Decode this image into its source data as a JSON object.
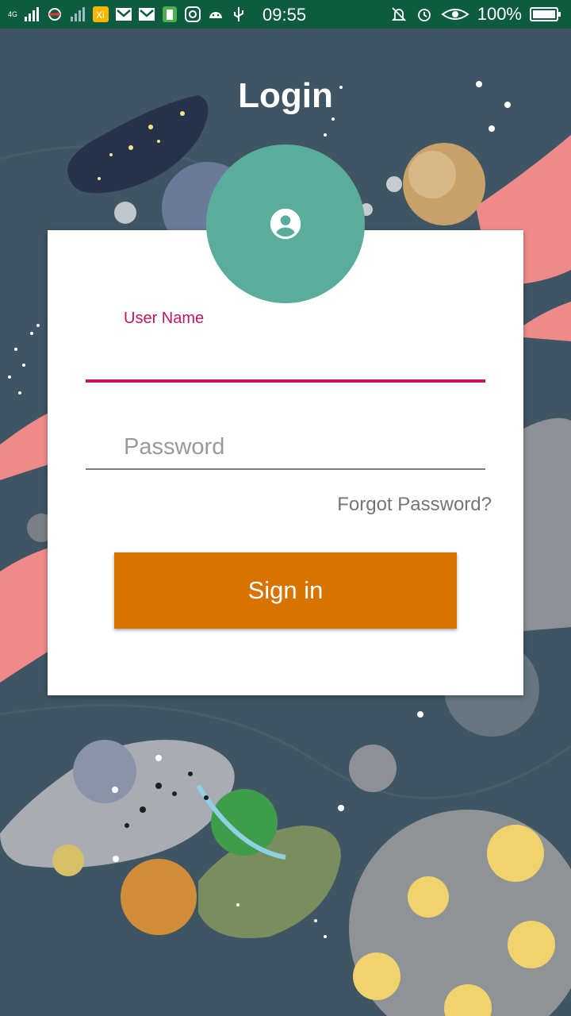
{
  "status_bar": {
    "network_label": "4G",
    "time": "09:55",
    "battery_percent": "100%"
  },
  "page": {
    "title": "Login"
  },
  "form": {
    "username_label": "User Name",
    "username_value": "",
    "password_placeholder": "Password",
    "forgot_password": "Forgot Password?",
    "signin_label": "Sign in"
  },
  "colors": {
    "status_bar": "#0d5c3f",
    "background": "#3f5563",
    "avatar": "#5aad9b",
    "accent": "#c2185b",
    "signin_button": "#d87300"
  },
  "icons": [
    "signal-icon",
    "mail-icon",
    "battery-icon",
    "instagram-icon",
    "android-icon",
    "usb-icon",
    "bell-off-icon",
    "alarm-icon",
    "eye-icon",
    "account-circle-icon"
  ]
}
